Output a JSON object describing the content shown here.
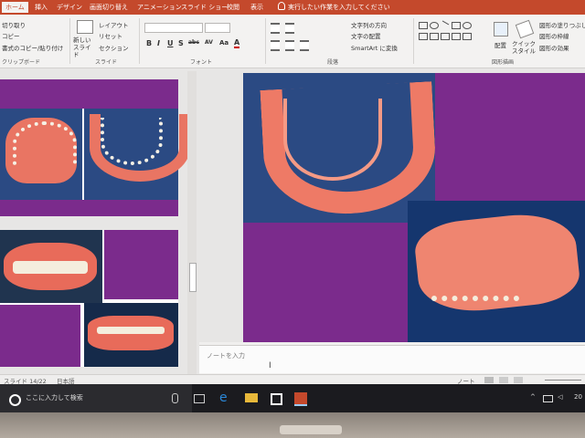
{
  "ribbon": {
    "tabs": [
      "ホーム",
      "挿入",
      "デザイン",
      "画面切り替え",
      "アニメーション",
      "スライド ショー",
      "校閲",
      "表示"
    ],
    "tell_me": "実行したい作業を入力してください",
    "clipboard": {
      "cut": "切り取り",
      "copy": "コピー",
      "format_painter": "書式のコピー/貼り付け",
      "group": "クリップボード"
    },
    "slides": {
      "new_slide": "新しい スライド",
      "layout": "レイアウト",
      "reset": "リセット",
      "section": "セクション",
      "group": "スライド"
    },
    "font": {
      "group": "フォント",
      "buttons": [
        "B",
        "I",
        "U",
        "S",
        "abc",
        "AV",
        "Aa",
        "A"
      ]
    },
    "paragraph": {
      "text_direction": "文字列の方向",
      "align_text": "文字の配置",
      "smartart": "SmartArt に変換",
      "group": "段落"
    },
    "drawing": {
      "arrange": "配置",
      "quick_styles": "クイック スタイル",
      "fill": "図形の塗りつぶし",
      "outline": "図形の枠線",
      "effects": "図形の効果",
      "group": "図形描画"
    }
  },
  "notes": {
    "placeholder": "ノートを入力"
  },
  "status": {
    "slide_count": "スライド 14/22",
    "language": "日本語",
    "notes_btn": "ノート"
  },
  "taskbar": {
    "search": "ここに入力して検索",
    "time": "20"
  },
  "colors": {
    "accent": "#c4492c",
    "purple": "#7b2b8c",
    "photo_bg": "#2b4a83"
  }
}
